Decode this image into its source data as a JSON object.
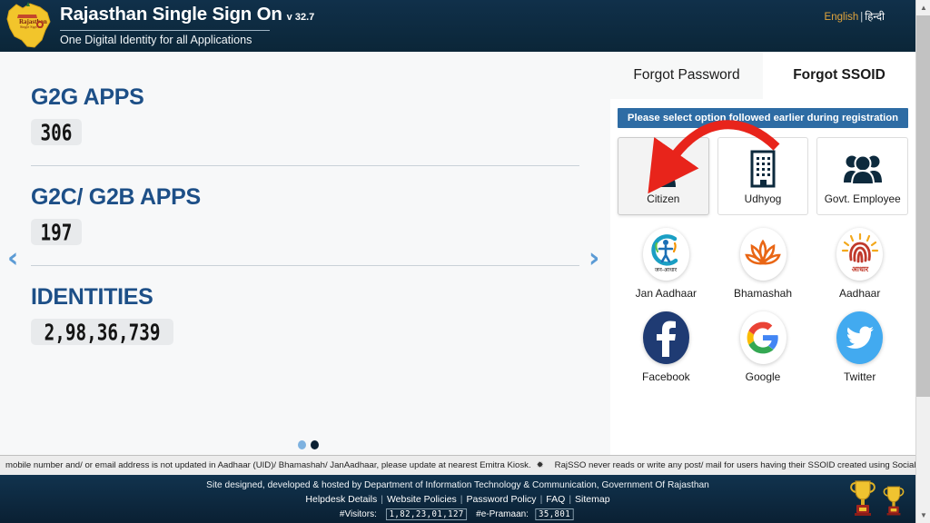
{
  "header": {
    "logo_alt": "rajasthan-state-map-logo",
    "title": "Rajasthan Single Sign On",
    "version": "v 32.7",
    "subtitle": "One Digital Identity for all Applications",
    "lang_english": "English",
    "lang_separator": "|",
    "lang_hindi": "हिन्दी"
  },
  "left": {
    "stats": [
      {
        "title": "G2G APPS",
        "value": "306"
      },
      {
        "title": "G2C/ G2B APPS",
        "value": "197"
      },
      {
        "title": "IDENTITIES",
        "value": "2,98,36,739"
      }
    ],
    "prev_arrow": "‹",
    "next_arrow": "›",
    "dots": [
      {
        "state": "inactive"
      },
      {
        "state": "active"
      }
    ]
  },
  "right": {
    "tabs": [
      {
        "label": "Forgot Password",
        "active": false
      },
      {
        "label": "Forgot SSOID",
        "active": true
      }
    ],
    "notice": "Please select option followed earlier during registration",
    "options": [
      {
        "label": "Citizen",
        "icon": "citizen-person-icon",
        "selected": true
      },
      {
        "label": "Udhyog",
        "icon": "udhyog-building-icon",
        "selected": false
      },
      {
        "label": "Govt. Employee",
        "icon": "govt-employee-group-icon",
        "selected": false
      }
    ],
    "identity_providers": [
      {
        "label": "Jan Aadhaar",
        "icon": "jan-aadhaar-logo-icon"
      },
      {
        "label": "Bhamashah",
        "icon": "bhamashah-lotus-logo-icon"
      },
      {
        "label": "Aadhaar",
        "icon": "aadhaar-fingerprint-logo-icon"
      }
    ],
    "social_providers": [
      {
        "label": "Facebook",
        "icon": "facebook-logo-icon",
        "color": "#1f3b73"
      },
      {
        "label": "Google",
        "icon": "google-logo-icon",
        "color": "#ffffff"
      },
      {
        "label": "Twitter",
        "icon": "twitter-bird-logo-icon",
        "color": "#42aaf0"
      }
    ]
  },
  "marquee": {
    "text_left": "mobile number and/ or email address is not updated in Aadhaar (UID)/ Bhamashah/ JanAadhaar, please update at nearest Emitra Kiosk.",
    "separator": "✹",
    "text_right": "RajSSO never reads or write any post/ mail for users having their SSOID created using Social Media services like Facebook/ Google."
  },
  "footer": {
    "credit": "Site designed, developed & hosted by Department of Information Technology & Communication, Government Of Rajasthan",
    "links": [
      "Helpdesk Details",
      "Website Policies",
      "Password Policy",
      "FAQ",
      "Sitemap"
    ],
    "visitors_label": "#Visitors:",
    "visitors_value": "1,82,23,01,127",
    "epramaan_label": "#e-Pramaan:",
    "epramaan_value": "35,801",
    "trophy_icon": "gold-trophy-icon"
  },
  "annotation": {
    "arrow": "red-curved-arrow-pointing-to-citizen"
  },
  "colors": {
    "header_bg": "#0e2b42",
    "accent_blue": "#1d4f87",
    "notice_bg": "#2e6ca4",
    "annotation_red": "#e8241b"
  }
}
